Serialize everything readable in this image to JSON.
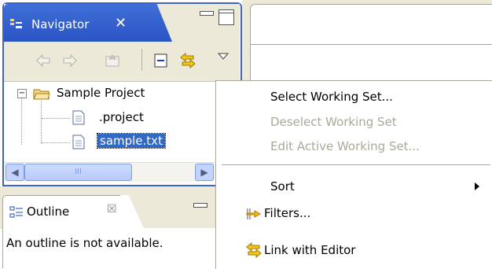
{
  "navigator": {
    "title": "Navigator",
    "close_glyph": "✕",
    "tree": {
      "project": "Sample Project",
      "files": [
        ".project",
        "sample.txt"
      ]
    },
    "scroll_thumb_grip": "III",
    "scroll_left_glyph": "◀",
    "scroll_right_glyph": "▶"
  },
  "outline": {
    "title": "Outline",
    "close_glyph": "☒",
    "message": "An outline is not available."
  },
  "menu": {
    "items": [
      {
        "label": "Select Working Set...",
        "enabled": true
      },
      {
        "label": "Deselect Working Set",
        "enabled": false
      },
      {
        "label": "Edit Active Working Set...",
        "enabled": false
      },
      {
        "label": "Sort",
        "enabled": true,
        "submenu": true
      },
      {
        "label": "Filters...",
        "enabled": true,
        "icon": "filters-icon"
      },
      {
        "label": "Link with Editor",
        "enabled": true,
        "icon": "link-icon"
      }
    ]
  },
  "colors": {
    "active_tab": "#2b54c3",
    "selection": "#316ac5",
    "chrome": "#ece9d8",
    "disabled_text": "#aca899"
  },
  "icons": [
    "navigator-icon",
    "back-icon",
    "forward-icon",
    "up-icon",
    "collapse-all-icon",
    "link-editor-icon",
    "view-menu-icon",
    "folder-icon",
    "file-icon",
    "outline-icon"
  ]
}
